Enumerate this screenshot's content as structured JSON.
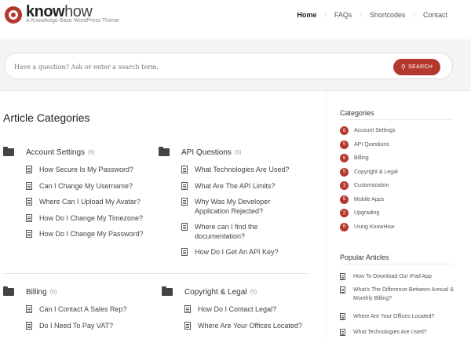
{
  "header": {
    "logo_bold": "know",
    "logo_light": "how",
    "tagline": "A Knowledge Base WordPress Theme",
    "nav": [
      {
        "label": "Home",
        "active": true
      },
      {
        "label": "FAQs",
        "active": false
      },
      {
        "label": "Shortcodes",
        "active": false
      },
      {
        "label": "Contact",
        "active": false
      }
    ]
  },
  "search": {
    "placeholder": "Have a question? Ask or enter a search term.",
    "button_label": "SEARCH"
  },
  "main": {
    "title": "Article Categories",
    "categories": [
      {
        "name": "Account Settings",
        "count": "(6)",
        "articles": [
          "How Secure Is My Password?",
          "Can I Change My Username?",
          "Where Can I Upload My Avatar?",
          "How Do I Change My Timezone?",
          "How Do I Change My Password?"
        ]
      },
      {
        "name": "API Questions",
        "count": "(5)",
        "articles": [
          "What Technologies Are Used?",
          "What Are The API Limits?",
          "Why Was My Developer Application Rejected?",
          "Where can I find the documentation?",
          "How Do I Get An API Key?"
        ]
      },
      {
        "name": "Billing",
        "count": "(6)",
        "articles": [
          "Can I Contact A Sales Rep?",
          "Do I Need To Pay VAT?"
        ]
      },
      {
        "name": "Copyright & Legal",
        "count": "(5)",
        "articles": [
          "How Do I Contact Legal?",
          "Where Are Your Offices Located?"
        ]
      }
    ]
  },
  "sidebar": {
    "categories_title": "Categories",
    "categories": [
      {
        "count": "6",
        "label": "Account Settings"
      },
      {
        "count": "5",
        "label": "API Questions"
      },
      {
        "count": "6",
        "label": "Billing"
      },
      {
        "count": "5",
        "label": "Copyright & Legal"
      },
      {
        "count": "3",
        "label": "Customization"
      },
      {
        "count": "5",
        "label": "Mobile Apps"
      },
      {
        "count": "2",
        "label": "Upgrading"
      },
      {
        "count": "6",
        "label": "Using KnowHow"
      }
    ],
    "popular_title": "Popular Articles",
    "popular": [
      "How To Download Our iPad App",
      "What's The Difference Between Annual & Monthly Billing?",
      "Where Are Your Offices Located?",
      "What Technologies Are Used?"
    ]
  },
  "colors": {
    "accent": "#b5382c",
    "text": "#333333",
    "band": "#f4f4f4"
  }
}
